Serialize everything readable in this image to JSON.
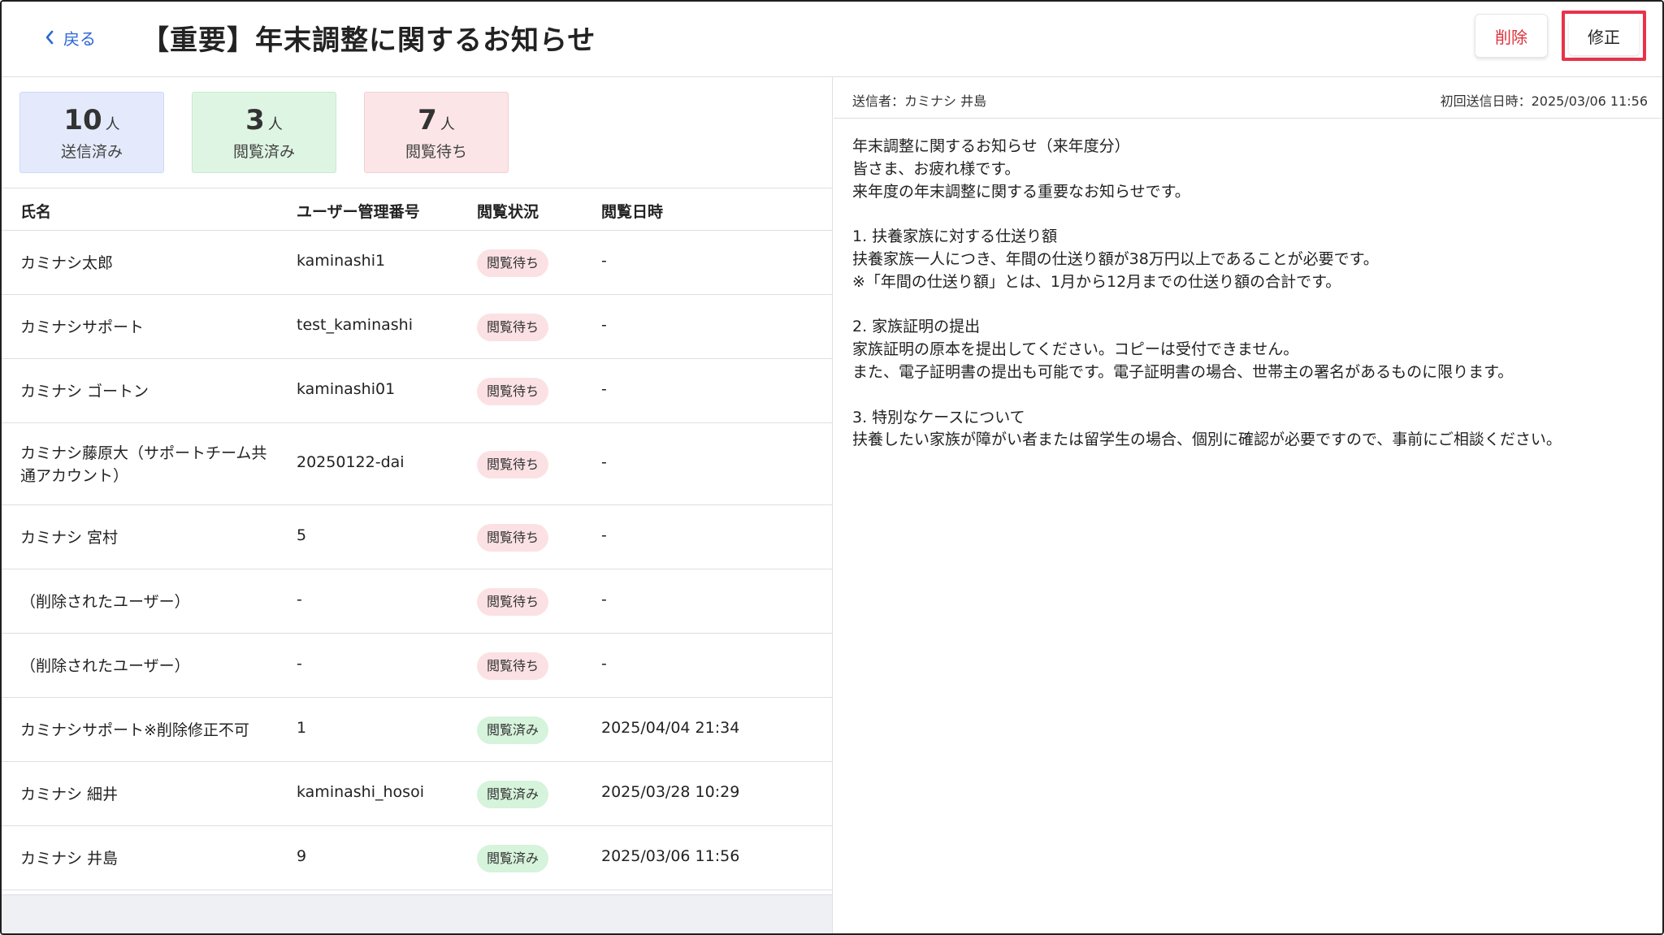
{
  "header": {
    "back_label": "戻る",
    "title": "【重要】年末調整に関するお知らせ",
    "delete_label": "削除",
    "edit_label": "修正"
  },
  "stats": {
    "unit": "人",
    "sent": {
      "count": "10",
      "label": "送信済み"
    },
    "read": {
      "count": "3",
      "label": "閲覧済み"
    },
    "waiting": {
      "count": "7",
      "label": "閲覧待ち"
    }
  },
  "table": {
    "columns": [
      "氏名",
      "ユーザー管理番号",
      "閲覧状況",
      "閲覧日時"
    ],
    "rows": [
      {
        "name": "カミナシ太郎",
        "user_id": "kaminashi1",
        "status": "閲覧待ち",
        "viewed_at": "-"
      },
      {
        "name": "カミナシサポート",
        "user_id": "test_kaminashi",
        "status": "閲覧待ち",
        "viewed_at": "-"
      },
      {
        "name": "カミナシ ゴートン",
        "user_id": "kaminashi01",
        "status": "閲覧待ち",
        "viewed_at": "-"
      },
      {
        "name": "カミナシ藤原大（サポートチーム共通アカウント）",
        "user_id": "20250122-dai",
        "status": "閲覧待ち",
        "viewed_at": "-"
      },
      {
        "name": "カミナシ 宮村",
        "user_id": "5",
        "status": "閲覧待ち",
        "viewed_at": "-"
      },
      {
        "name": "（削除されたユーザー）",
        "user_id": "-",
        "status": "閲覧待ち",
        "viewed_at": "-"
      },
      {
        "name": "（削除されたユーザー）",
        "user_id": "-",
        "status": "閲覧待ち",
        "viewed_at": "-"
      },
      {
        "name": "カミナシサポート※削除修正不可",
        "user_id": "1",
        "status": "閲覧済み",
        "viewed_at": "2025/04/04 21:34"
      },
      {
        "name": "カミナシ 細井",
        "user_id": "kaminashi_hosoi",
        "status": "閲覧済み",
        "viewed_at": "2025/03/28 10:29"
      },
      {
        "name": "カミナシ 井島",
        "user_id": "9",
        "status": "閲覧済み",
        "viewed_at": "2025/03/06 11:56"
      }
    ]
  },
  "message": {
    "sender": "送信者：カミナシ 井島",
    "first_sent": "初回送信日時：2025/03/06 11:56",
    "body": "年末調整に関するお知らせ（来年度分）\n皆さま、お疲れ様です。\n来年度の年末調整に関する重要なお知らせです。\n\n1. 扶養家族に対する仕送り額\n扶養家族一人につき、年間の仕送り額が38万円以上であることが必要です。\n※「年間の仕送り額」とは、1月から12月までの仕送り額の合計です。\n\n2. 家族証明の提出\n家族証明の原本を提出してください。コピーは受付できません。\nまた、電子証明書の提出も可能です。電子証明書の場合、世帯主の署名があるものに限ります。\n\n3. 特別なケースについて\n扶養したい家族が障がい者または留学生の場合、個別に確認が必要ですので、事前にご相談ください。"
  },
  "colors": {
    "accent": "#2d66d6",
    "danger": "#e0303a",
    "highlight_border": "#e8334a",
    "badge_waiting": "#fbe1e4",
    "badge_read": "#d6f3dc"
  }
}
